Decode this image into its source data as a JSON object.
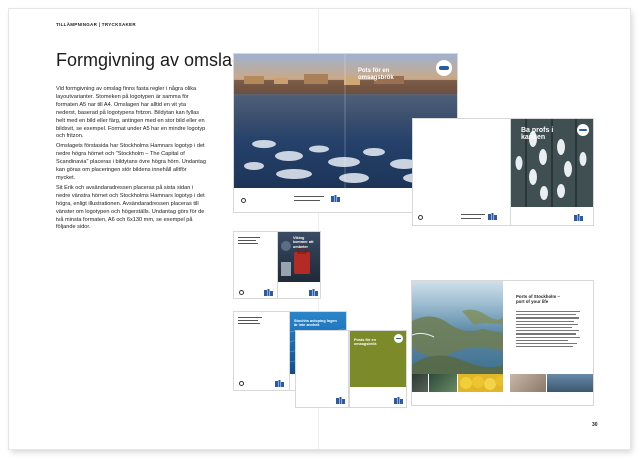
{
  "page": {
    "running_head": "TILLÄMPNINGAR | TRYCKSAKER",
    "title": "Formgivning av omslag",
    "paragraphs": [
      "Vid formgivning av omslag finns fasta regler i några olika layoutvarianter. Stomeken på logotypen är samma för formaten A5 nar till A4. Omslagen har alltid en vit yta nederst, baserad på logotypens fritzon. Bildytan kan fyllas helt med en bild eller färg, antingen med en stor bild eller en bildsvit, se exempel. Format under A5 har en mindre logotyp och fritzon.",
      "Omslagets förstasida har Stockholms Hamnars logotyp i det nedre högra hörnet och \"Stockholm – The Capital of Scandinavia\" placeras i bildytans övre högra hörn. Undantag kan göras om placeringen stör bildens innehåll alltför mycket.",
      "Sit Erik och avsändaradressen placeras på sista sidan i nedre vänstra hörnet och Stockholms Hamnars logotyp i det högra, enligt illustrationen. Avsändaradressen placeras till vänster om logotypen och högerställs. Undantag görs för de två minsta formaten, A6 och 6x130 mm, se exempel på följande sidor."
    ],
    "page_number": "30"
  },
  "covers": {
    "large_title": "Pots för en omsagsbrök",
    "boats_title": "Ba profs i kansen",
    "small_red_title": "Viking kommer att ombeter",
    "water_title": "Stochhs avloping Ingen är inte anvhek",
    "olive_title": "Posts för en omsagsbrök",
    "spread_heading": "Ports of Stockholm – port of your life"
  },
  "colors": {
    "brand_blue": "#2a5aa8",
    "olive": "#7c8a2a",
    "water": "#1a6fb8"
  }
}
